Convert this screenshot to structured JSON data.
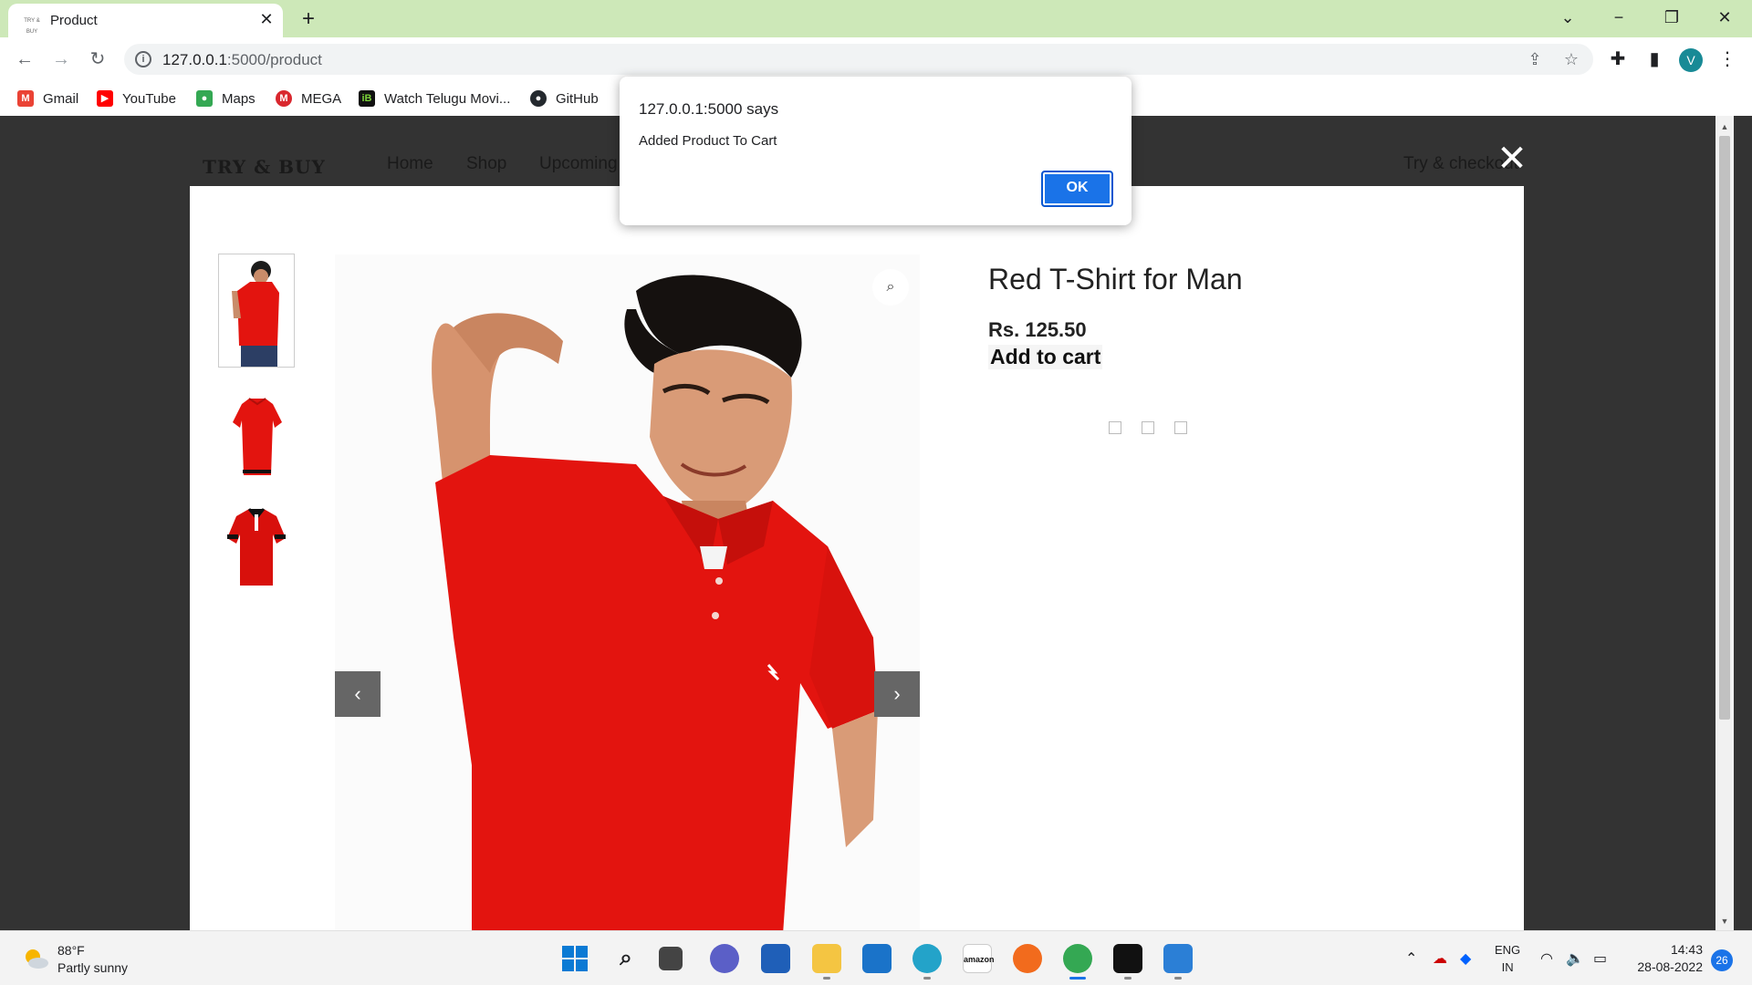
{
  "browser": {
    "tab_title": "Product",
    "tab_favicon_text": "TRY & BUY",
    "tab_close": "✕",
    "new_tab": "+",
    "url_host": "127.0.0.1",
    "url_rest": ":5000/product",
    "profile_initial": "V",
    "bookmarks": [
      {
        "label": "Gmail",
        "icon": "gmail-icon",
        "color": "#ea4335",
        "glyph": "M"
      },
      {
        "label": "YouTube",
        "icon": "youtube-icon",
        "color": "#ff0000",
        "glyph": "▶"
      },
      {
        "label": "Maps",
        "icon": "maps-icon",
        "color": "#34a853",
        "glyph": "●"
      },
      {
        "label": "MEGA",
        "icon": "mega-icon",
        "color": "#d9272e",
        "glyph": "M"
      },
      {
        "label": "Watch Telugu Movi...",
        "icon": "ibomma-icon",
        "color": "#111111",
        "glyph": "iB"
      },
      {
        "label": "GitHub",
        "icon": "github-icon",
        "color": "#24292e",
        "glyph": "●"
      }
    ]
  },
  "site": {
    "logo": "TRY & BUY",
    "nav": [
      "Home",
      "Shop",
      "Upcoming"
    ],
    "try_checkout": "Try & checkout",
    "close": "✕"
  },
  "product": {
    "title": "Red T-Shirt for Man",
    "price": "Rs. 125.50",
    "add_to_cart": "Add to cart",
    "colors": {
      "shirt": "#e3140f",
      "dark": "#b00e0a"
    }
  },
  "alert": {
    "title": "127.0.0.1:5000 says",
    "message": "Added Product To Cart",
    "ok": "OK"
  },
  "taskbar": {
    "temperature": "88°F",
    "weather": "Partly sunny",
    "lang_1": "ENG",
    "lang_2": "IN",
    "time": "14:43",
    "date": "28-08-2022",
    "notifications": "26"
  }
}
